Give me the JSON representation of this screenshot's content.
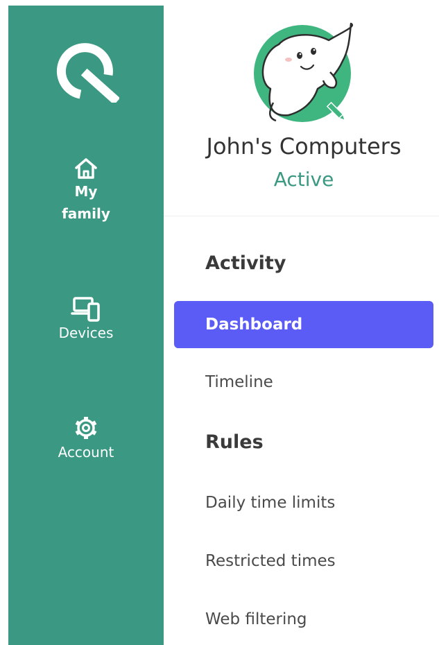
{
  "sidebar": {
    "items": [
      {
        "label_line1": "My",
        "label_line2": "family",
        "icon": "home-icon"
      },
      {
        "label": "Devices",
        "icon": "devices-icon"
      },
      {
        "label": "Account",
        "icon": "gear-icon"
      }
    ]
  },
  "profile": {
    "name": "John's Computers",
    "status": "Active"
  },
  "menu": {
    "activity_heading": "Activity",
    "dashboard": "Dashboard",
    "timeline": "Timeline",
    "rules_heading": "Rules",
    "daily_time_limits": "Daily time limits",
    "restricted_times": "Restricted times",
    "web_filtering": "Web filtering"
  },
  "colors": {
    "sidebar_bg": "#3a9883",
    "active_item_bg": "#5b5cf6",
    "status_text": "#3a9883"
  }
}
